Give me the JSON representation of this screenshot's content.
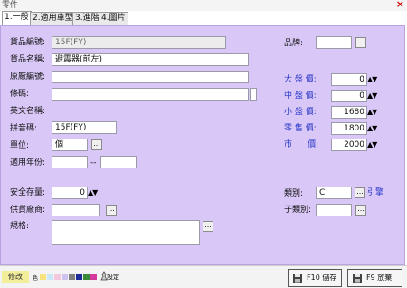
{
  "window": {
    "title": "零件"
  },
  "tabs": [
    {
      "label": "1.一般",
      "active": true
    },
    {
      "label": "2.適用車型",
      "active": false
    },
    {
      "label": "3.進階",
      "active": false
    },
    {
      "label": "4.圖片",
      "active": false
    }
  ],
  "form": {
    "product_code": {
      "label": "貨品編號:",
      "value": "15F(FY)"
    },
    "product_name": {
      "label": "貨品名稱:",
      "value": "避震器(前左)"
    },
    "original_code": {
      "label": "原廠編號:",
      "value": ""
    },
    "barcode": {
      "label": "條碼:",
      "value": "",
      "value2": ""
    },
    "english_name": {
      "label": "英文名稱:"
    },
    "pinyin": {
      "label": "拼音碼:",
      "value": "15F(FY)"
    },
    "unit": {
      "label": "單位:",
      "value": "個"
    },
    "years": {
      "label": "適用年份:",
      "from": "",
      "sep": "--",
      "to": ""
    },
    "safety_stock": {
      "label": "安全存量:",
      "value": "0"
    },
    "supplier": {
      "label": "供貨廠商:",
      "value": ""
    },
    "spec": {
      "label": "規格:",
      "value": ""
    },
    "brand": {
      "label": "品牌:",
      "value": ""
    },
    "prices": [
      {
        "label": "大 盤 價:",
        "value": "0"
      },
      {
        "label": "中 盤 價:",
        "value": "0"
      },
      {
        "label": "小 盤 價:",
        "value": "1680"
      },
      {
        "label": "零 售 價:",
        "value": "1800"
      },
      {
        "label": "市      價:",
        "value": "2000"
      }
    ],
    "category": {
      "label": "類別:",
      "value": "C",
      "link": "引擎"
    },
    "subcategory": {
      "label": "子類別:",
      "value": ""
    }
  },
  "footer": {
    "status": "修改",
    "setting_label": "設定",
    "save_button": "F10 儲存",
    "discard_button": "F9 放棄",
    "swatch_label": "色"
  },
  "colors": {
    "panel_bg": "#d9c8f7",
    "link": "#2b38c9",
    "status_bg": "#f2ee9a",
    "swatches": [
      "#f8e27c",
      "#c9e7f7",
      "#f3c6dc",
      "#cfc2ef",
      "#7d7d7d",
      "#1f2a9a",
      "#3a8a3a",
      "#d23b9c"
    ]
  }
}
